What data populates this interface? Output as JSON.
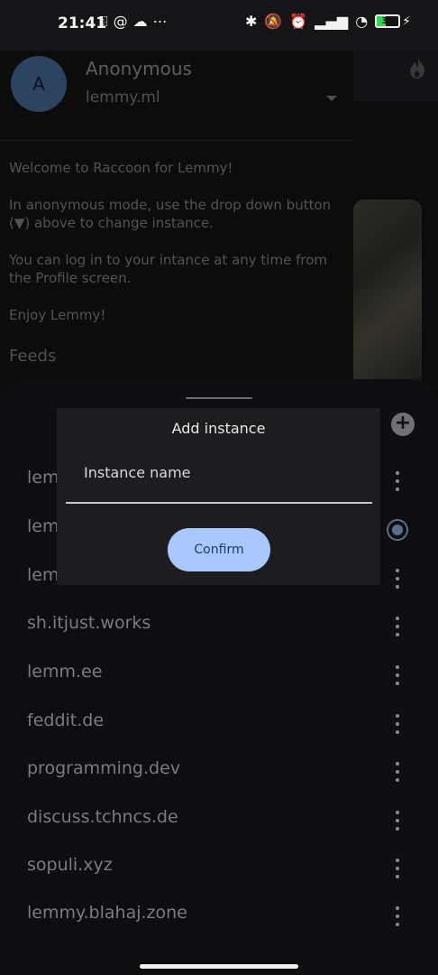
{
  "status_bar": {
    "time": "21:41",
    "left_icons": [
      "sim-icon",
      "threads-icon",
      "cloud-icon",
      "more-icon"
    ],
    "right_icons": [
      "bluetooth-icon",
      "mute-icon",
      "alarm-icon",
      "signal-icon",
      "wifi-icon"
    ],
    "battery_percent": 39,
    "battery_label": "39",
    "charging": true
  },
  "drawer": {
    "avatar_letter": "A",
    "account_name": "Anonymous",
    "instance": "lemmy.ml",
    "welcome_lines": [
      "Welcome to Raccoon for Lemmy!",
      "In anonymous mode, use the drop down button (▼) above to change instance.",
      "You can log in to your intance at any time from the Profile screen.",
      "Enjoy Lemmy!"
    ],
    "feeds_label": "Feeds"
  },
  "dialog": {
    "title": "Add instance",
    "field_label": "Instance name",
    "confirm_label": "Confirm"
  },
  "instances": [
    {
      "label": "lemmy.world",
      "visible_text": "lem",
      "action": "kebab"
    },
    {
      "label": "lemmy.ml",
      "visible_text": "lem",
      "action": "radio-selected"
    },
    {
      "label": "lemmy.ca",
      "visible_text": "lem",
      "action": "kebab"
    },
    {
      "label": "sh.itjust.works",
      "visible_text": "sh.itjust.works",
      "action": "kebab"
    },
    {
      "label": "lemm.ee",
      "visible_text": "lemm.ee",
      "action": "kebab"
    },
    {
      "label": "feddit.de",
      "visible_text": "feddit.de",
      "action": "kebab"
    },
    {
      "label": "programming.dev",
      "visible_text": "programming.dev",
      "action": "kebab"
    },
    {
      "label": "discuss.tchncs.de",
      "visible_text": "discuss.tchncs.de",
      "action": "kebab"
    },
    {
      "label": "sopuli.xyz",
      "visible_text": "sopuli.xyz",
      "action": "kebab"
    },
    {
      "label": "lemmy.blahaj.zone",
      "visible_text": "lemmy.blahaj.zone",
      "action": "kebab"
    }
  ],
  "colors": {
    "accent": "#a9c8ff",
    "radio": "#5a6e8c",
    "sheet_bg": "#0e0e10",
    "dialog_bg": "#1d1d20"
  }
}
